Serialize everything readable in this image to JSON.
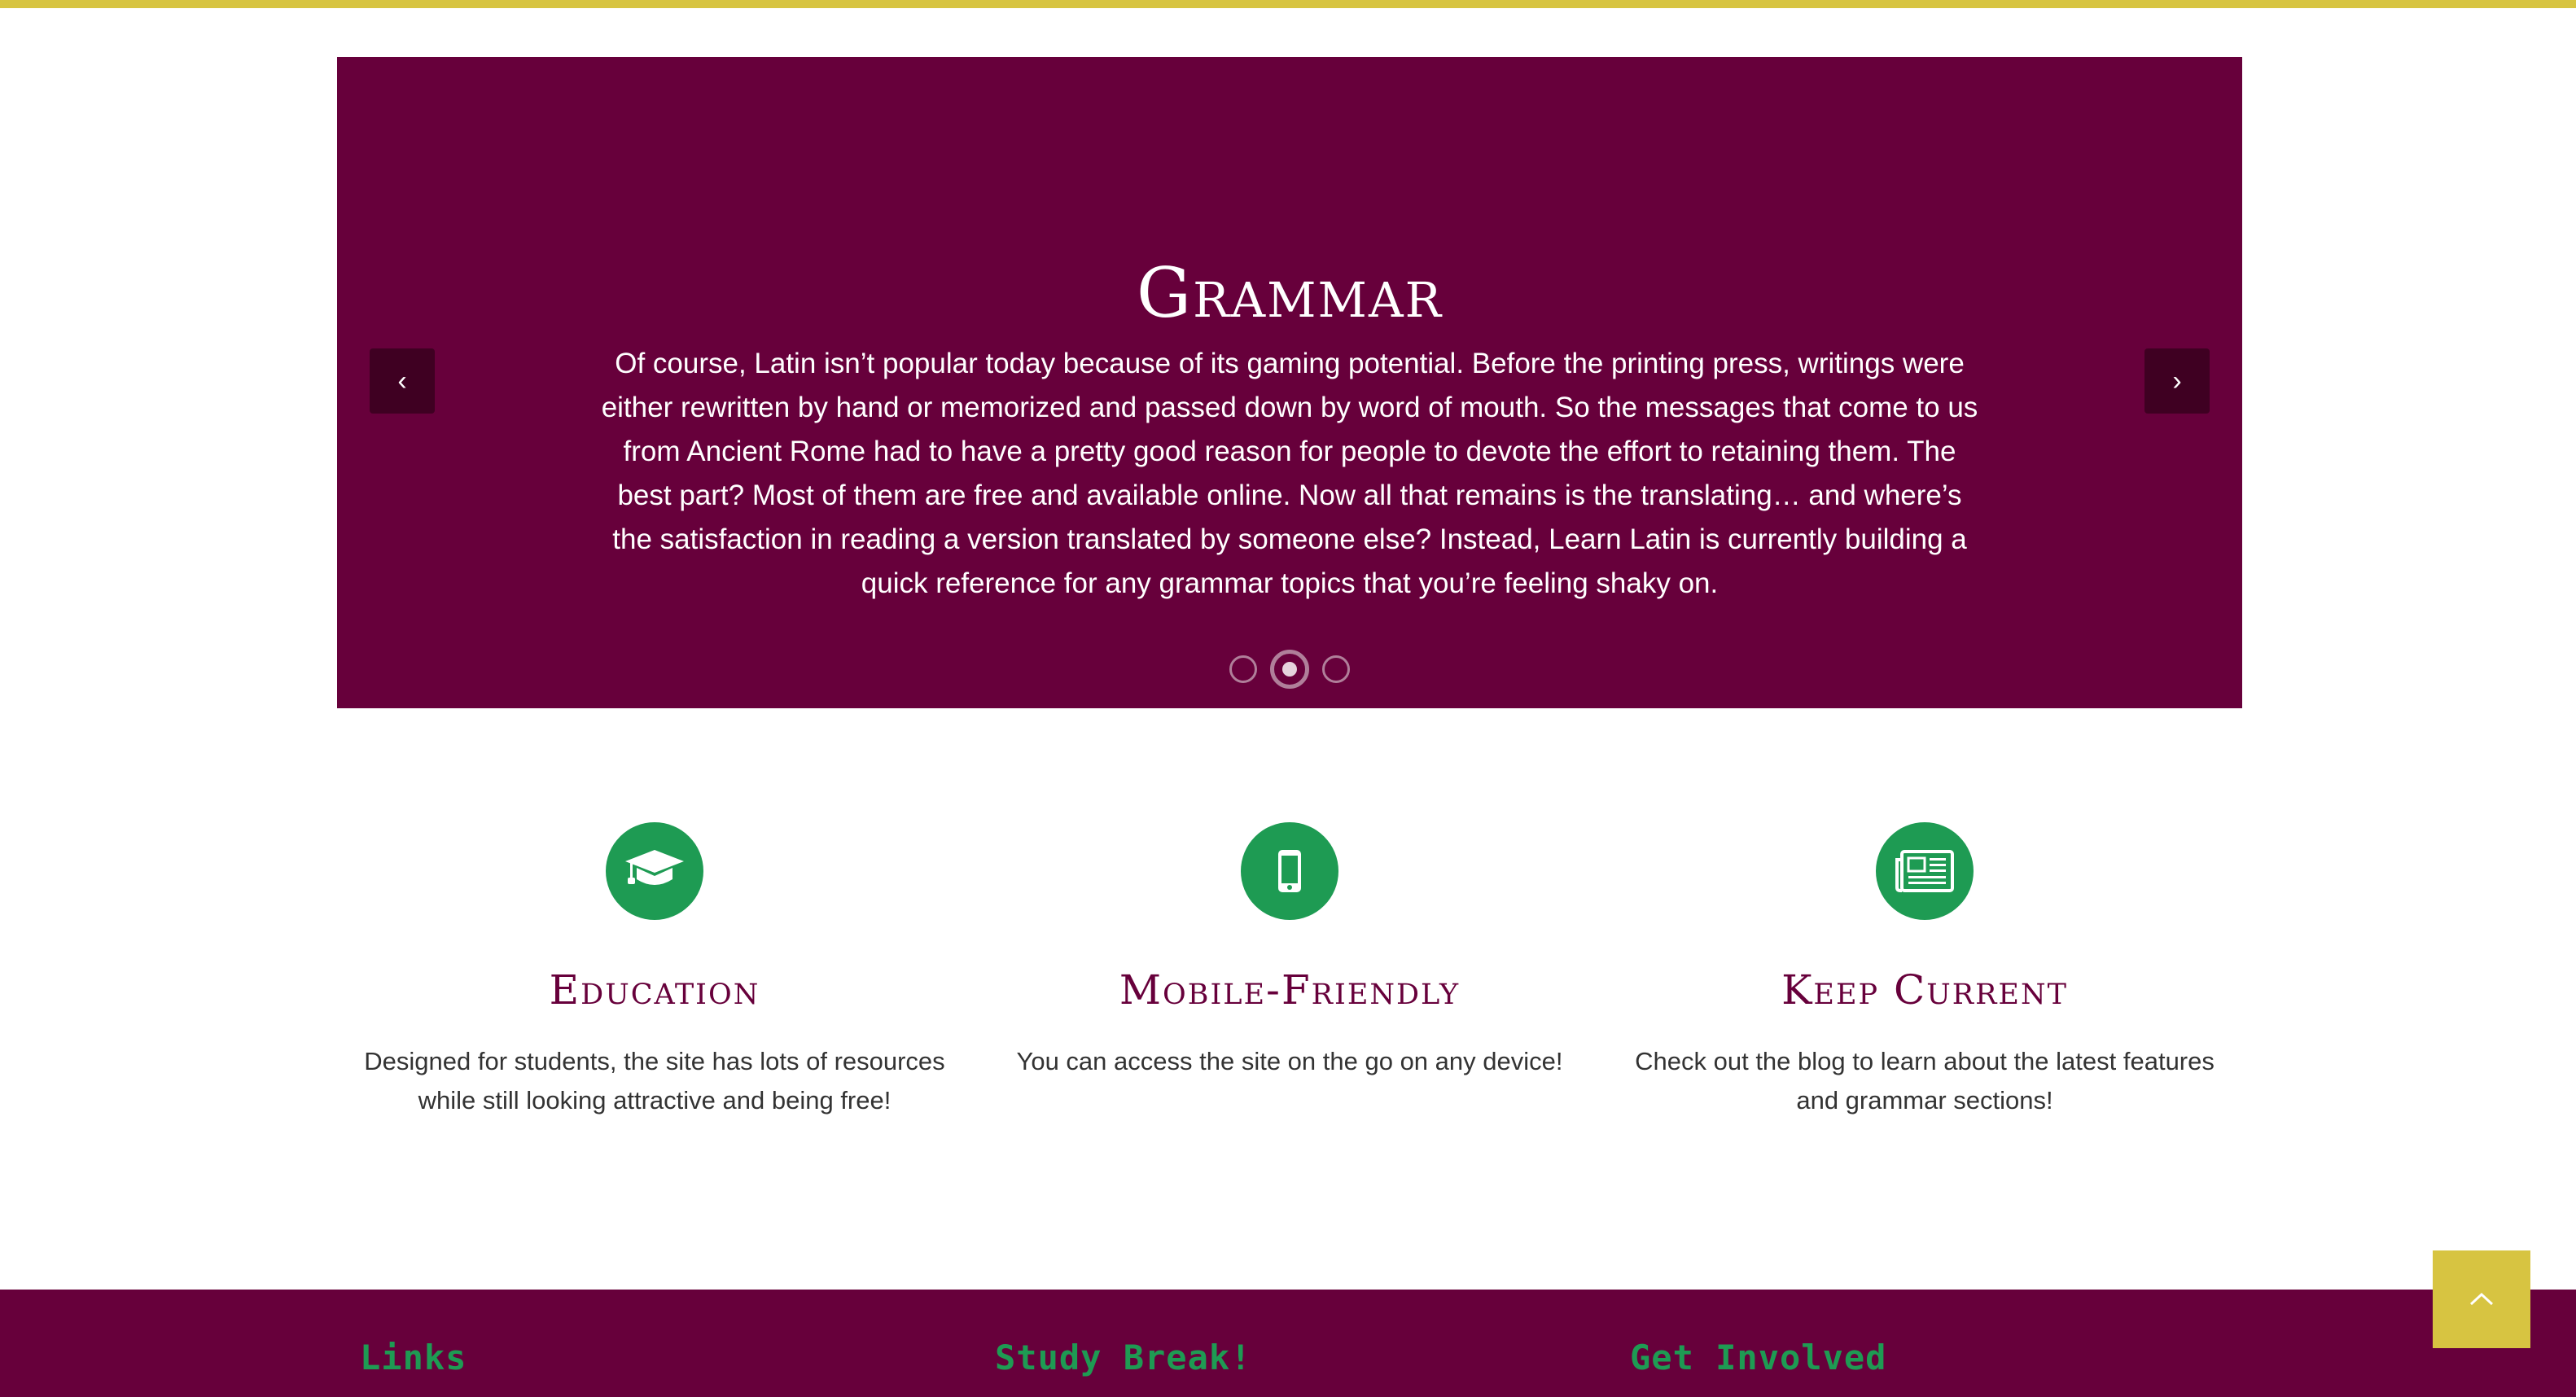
{
  "slider": {
    "title": "Grammar",
    "body": "Of course, Latin isn’t popular today because of its gaming potential. Before the printing press, writings were either rewritten by hand or memorized and passed down by word of mouth. So the messages that come to us from Ancient Rome had to have a pretty good reason for people to devote the effort to retaining them. The best part? Most of them are free and available online. Now all that remains is the translating… and where’s the satisfaction in reading a version translated by someone else? Instead, Learn Latin is currently building a quick reference for any grammar topics that you’re feeling shaky on.",
    "prev_icon": "chevron-left-icon",
    "next_icon": "chevron-right-icon",
    "prev_glyph": "‹",
    "next_glyph": "›",
    "active_dot": 2,
    "dot_count": 3
  },
  "features": [
    {
      "icon": "graduation-cap-icon",
      "title": "Education",
      "text": "Designed for students, the site has lots of resources while still looking attractive and being free!"
    },
    {
      "icon": "mobile-phone-icon",
      "title": "Mobile-Friendly",
      "text": "You can access the site on the go on any device!"
    },
    {
      "icon": "newspaper-icon",
      "title": "Keep Current",
      "text": "Check out the blog to learn about the latest features and grammar sections!"
    }
  ],
  "footer": {
    "links_heading": "Links",
    "study_heading": "Study Break!",
    "involved_heading": "Get Involved"
  },
  "back_to_top": {
    "icon": "chevron-up-icon"
  },
  "colors": {
    "accent_yellow": "#d7c441",
    "brand_maroon": "#67003b",
    "icon_green": "#1e9b53"
  }
}
